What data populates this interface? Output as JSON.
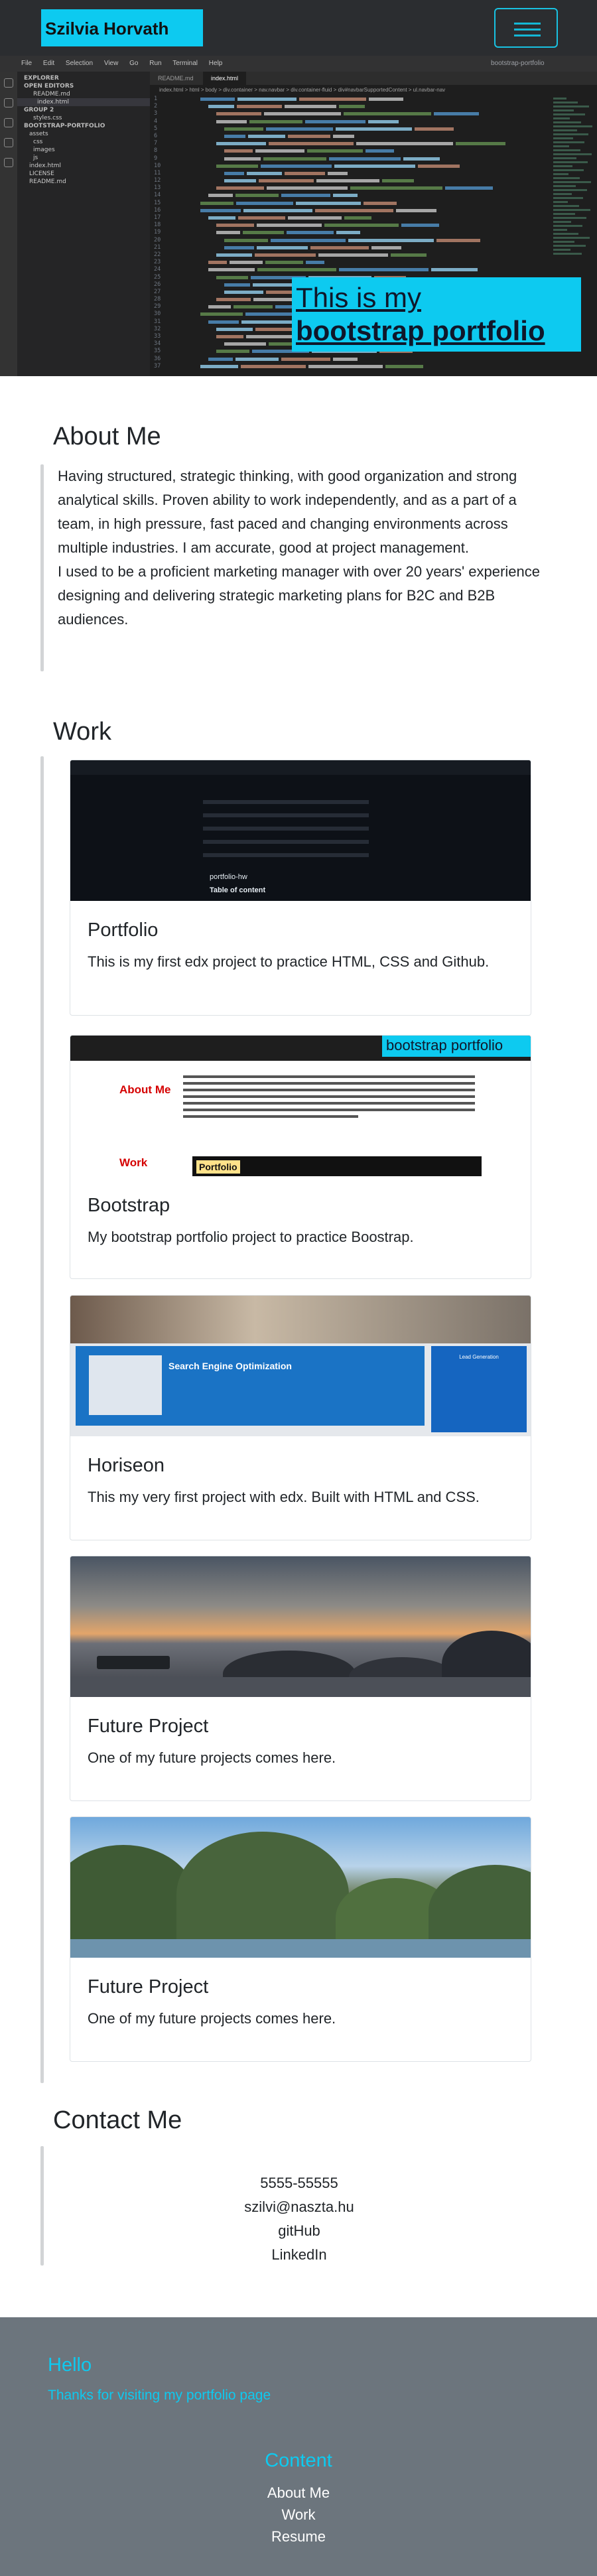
{
  "navbar": {
    "brand": "Szilvia Horvath"
  },
  "editor": {
    "menu": [
      "File",
      "Edit",
      "Selection",
      "View",
      "Go",
      "Run",
      "Terminal",
      "Help"
    ],
    "command_center": "bootstrap-portfolio",
    "tabs": [
      "README.md",
      "index.html"
    ],
    "breadcrumb": "index.html > html > body > div.container > nav.navbar > div.container-fluid > div#navbarSupportedContent > ul.navbar-nav",
    "explorer_header": "EXPLORER",
    "explorer_items": [
      "OPEN EDITORS",
      "README.md",
      "index.html",
      "GROUP 2",
      "styles.css",
      "BOOTSTRAP-PORTFOLIO",
      "assets",
      "css",
      "images",
      "js",
      "index.html",
      "LICENSE",
      "README.md"
    ]
  },
  "hero": {
    "title_line1": "This is my",
    "title_line2": "bootstrap portfolio"
  },
  "about": {
    "heading": "About Me",
    "paragraph1": "Having structured, strategic thinking, with good organization and strong analytical skills. Proven ability to work independently, and as a part of a team, in high pressure, fast paced and changing environments across multiple industries. I am accurate, good at project management.",
    "paragraph2": "I used to be a proficient marketing manager with over 20 years' experience designing and delivering strategic marketing plans for B2C and B2B audiences."
  },
  "work": {
    "heading": "Work",
    "projects": [
      {
        "title": "Portfolio",
        "text": "This is my first edx project to practice HTML, CSS and Github.",
        "thumb_label": "portfolio-hw",
        "thumb_sub": "Table of content"
      },
      {
        "title": "Bootstrap",
        "text": "My bootstrap portfolio project to practice Boostrap.",
        "thumb_banner": "bootstrap portfolio",
        "thumb_about": "About Me",
        "thumb_work": "Work",
        "thumb_portfolio": "Portfolio"
      },
      {
        "title": "Horiseon",
        "text": "This my very first project with edx. Built with HTML and CSS.",
        "thumb_label": "Search Engine Optimization",
        "thumb_side": "Lead Generation"
      },
      {
        "title": "Future Project",
        "text": "One of my future projects comes here."
      },
      {
        "title": "Future Project",
        "text": "One of my future projects comes here."
      }
    ]
  },
  "contact": {
    "heading": "Contact Me",
    "phone": "5555-55555",
    "email": "szilvi@naszta.hu",
    "github": "gitHub",
    "linkedin": "LinkedIn"
  },
  "footer": {
    "hello": "Hello",
    "thanks": "Thanks for visiting my portfolio page",
    "content_heading": "Content",
    "links": [
      "About Me",
      "Work",
      "Resume"
    ]
  },
  "colors": {
    "accent": "#0dcaf0",
    "footer_bg": "#6c757d",
    "rule": "#d2d4d6"
  }
}
